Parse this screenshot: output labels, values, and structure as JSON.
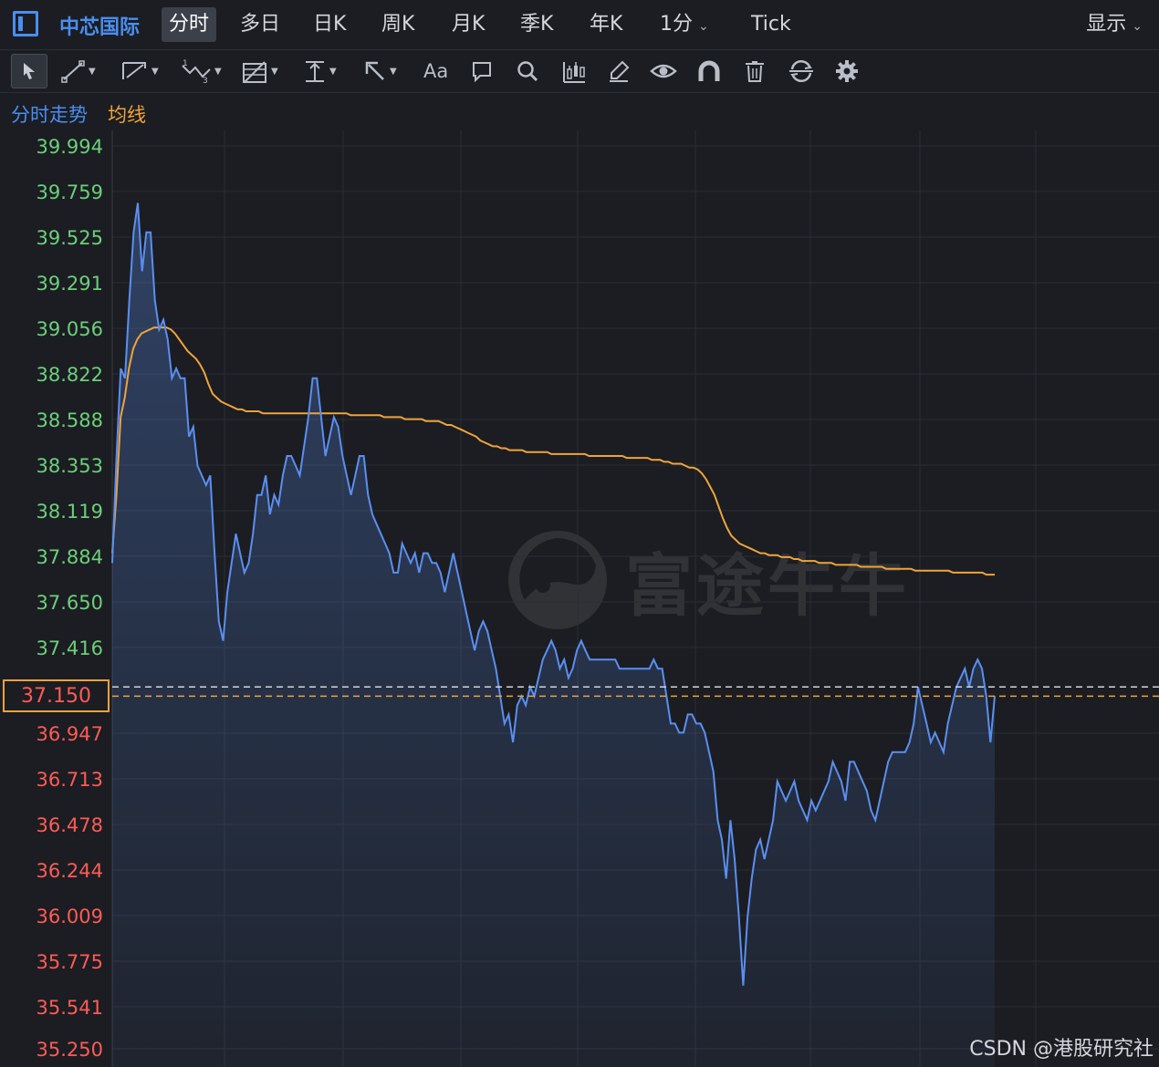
{
  "header": {
    "stock_name": "中芯国际",
    "tabs": [
      {
        "label": "分时",
        "active": true
      },
      {
        "label": "多日",
        "active": false
      },
      {
        "label": "日K",
        "active": false
      },
      {
        "label": "周K",
        "active": false
      },
      {
        "label": "月K",
        "active": false
      },
      {
        "label": "季K",
        "active": false
      },
      {
        "label": "年K",
        "active": false
      },
      {
        "label": "1分",
        "active": false
      },
      {
        "label": "Tick",
        "active": false
      }
    ],
    "display_menu": "显示"
  },
  "toolbar": {
    "icons": [
      "cursor-icon",
      "line-icon",
      "channel-icon",
      "wave-icon",
      "fib-icon",
      "measure-icon",
      "arrow-icon",
      "text-icon",
      "comment-icon",
      "zoom-icon",
      "candles-icon",
      "brush-icon",
      "eye-icon",
      "magnet-icon",
      "trash-icon",
      "sync-icon",
      "settings-icon"
    ],
    "text_tool_label": "Aa"
  },
  "legend": {
    "price_line": "分时走势",
    "avg_line": "均线"
  },
  "chart_data": {
    "type": "line",
    "title": "",
    "y_ticks": [
      "39.994",
      "39.759",
      "39.525",
      "39.291",
      "39.056",
      "38.822",
      "38.588",
      "38.353",
      "38.119",
      "37.884",
      "37.650",
      "37.416",
      "36.947",
      "36.713",
      "36.478",
      "36.244",
      "36.009",
      "35.775",
      "35.541",
      "35.250"
    ],
    "current_price_label": "37.150",
    "ylim": [
      35.25,
      39.994
    ],
    "reference_line": 37.2,
    "series": [
      {
        "name": "分时走势",
        "color": "#5b8ff0",
        "values": [
          37.85,
          38.4,
          38.85,
          38.8,
          39.2,
          39.55,
          39.7,
          39.35,
          39.55,
          39.55,
          39.2,
          39.05,
          39.1,
          39.0,
          38.8,
          38.85,
          38.8,
          38.8,
          38.5,
          38.55,
          38.35,
          38.3,
          38.25,
          38.3,
          37.9,
          37.55,
          37.45,
          37.7,
          37.85,
          38.0,
          37.9,
          37.8,
          37.85,
          38.0,
          38.2,
          38.2,
          38.3,
          38.1,
          38.2,
          38.15,
          38.3,
          38.4,
          38.4,
          38.35,
          38.3,
          38.45,
          38.6,
          38.8,
          38.8,
          38.6,
          38.4,
          38.5,
          38.6,
          38.55,
          38.4,
          38.3,
          38.2,
          38.3,
          38.4,
          38.4,
          38.2,
          38.1,
          38.05,
          38.0,
          37.95,
          37.9,
          37.8,
          37.8,
          37.95,
          37.9,
          37.85,
          37.9,
          37.8,
          37.9,
          37.9,
          37.85,
          37.85,
          37.8,
          37.7,
          37.8,
          37.9,
          37.8,
          37.7,
          37.6,
          37.5,
          37.4,
          37.5,
          37.55,
          37.5,
          37.4,
          37.3,
          37.15,
          37.0,
          37.05,
          36.9,
          37.1,
          37.15,
          37.1,
          37.2,
          37.15,
          37.25,
          37.35,
          37.4,
          37.45,
          37.4,
          37.3,
          37.35,
          37.25,
          37.3,
          37.4,
          37.45,
          37.4,
          37.35,
          37.35,
          37.35,
          37.35,
          37.35,
          37.35,
          37.35,
          37.3,
          37.3,
          37.3,
          37.3,
          37.3,
          37.3,
          37.3,
          37.3,
          37.35,
          37.3,
          37.3,
          37.15,
          37.0,
          37.0,
          36.95,
          36.95,
          37.05,
          37.05,
          37.0,
          37.0,
          36.95,
          36.85,
          36.75,
          36.5,
          36.4,
          36.2,
          36.5,
          36.3,
          36.0,
          35.65,
          36.0,
          36.2,
          36.35,
          36.4,
          36.3,
          36.4,
          36.5,
          36.7,
          36.65,
          36.6,
          36.65,
          36.7,
          36.6,
          36.55,
          36.5,
          36.6,
          36.55,
          36.6,
          36.65,
          36.7,
          36.8,
          36.75,
          36.7,
          36.6,
          36.8,
          36.8,
          36.75,
          36.7,
          36.65,
          36.55,
          36.5,
          36.6,
          36.7,
          36.8,
          36.85,
          36.85,
          36.85,
          36.85,
          36.9,
          37.0,
          37.2,
          37.1,
          37.0,
          36.9,
          36.95,
          36.9,
          36.85,
          37.0,
          37.1,
          37.2,
          37.25,
          37.3,
          37.2,
          37.3,
          37.35,
          37.3,
          37.15,
          36.9,
          37.15
        ]
      },
      {
        "name": "均线",
        "color": "#f0a33a",
        "values": [
          37.9,
          38.2,
          38.6,
          38.7,
          38.85,
          38.95,
          39.0,
          39.03,
          39.04,
          39.05,
          39.06,
          39.06,
          39.06,
          39.06,
          39.05,
          39.03,
          39.0,
          38.97,
          38.94,
          38.92,
          38.9,
          38.87,
          38.83,
          38.77,
          38.72,
          38.7,
          38.68,
          38.67,
          38.66,
          38.65,
          38.64,
          38.64,
          38.63,
          38.63,
          38.63,
          38.63,
          38.62,
          38.62,
          38.62,
          38.62,
          38.62,
          38.62,
          38.62,
          38.62,
          38.62,
          38.62,
          38.62,
          38.62,
          38.62,
          38.62,
          38.62,
          38.62,
          38.62,
          38.62,
          38.62,
          38.62,
          38.62,
          38.61,
          38.61,
          38.61,
          38.61,
          38.61,
          38.61,
          38.61,
          38.61,
          38.6,
          38.6,
          38.6,
          38.6,
          38.6,
          38.59,
          38.59,
          38.59,
          38.59,
          38.59,
          38.58,
          38.58,
          38.58,
          38.58,
          38.57,
          38.56,
          38.56,
          38.55,
          38.54,
          38.53,
          38.52,
          38.51,
          38.5,
          38.48,
          38.47,
          38.46,
          38.45,
          38.45,
          38.44,
          38.44,
          38.43,
          38.43,
          38.43,
          38.43,
          38.42,
          38.42,
          38.42,
          38.42,
          38.42,
          38.42,
          38.41,
          38.41,
          38.41,
          38.41,
          38.41,
          38.41,
          38.41,
          38.41,
          38.41,
          38.4,
          38.4,
          38.4,
          38.4,
          38.4,
          38.4,
          38.4,
          38.4,
          38.4,
          38.39,
          38.39,
          38.39,
          38.39,
          38.39,
          38.39,
          38.38,
          38.38,
          38.38,
          38.37,
          38.37,
          38.36,
          38.36,
          38.36,
          38.35,
          38.34,
          38.34,
          38.33,
          38.31,
          38.28,
          38.24,
          38.2,
          38.14,
          38.08,
          38.03,
          37.99,
          37.97,
          37.95,
          37.94,
          37.93,
          37.92,
          37.91,
          37.9,
          37.9,
          37.89,
          37.89,
          37.89,
          37.88,
          37.88,
          37.88,
          37.87,
          37.87,
          37.86,
          37.86,
          37.86,
          37.86,
          37.85,
          37.85,
          37.85,
          37.85,
          37.84,
          37.84,
          37.84,
          37.84,
          37.84,
          37.84,
          37.83,
          37.83,
          37.83,
          37.83,
          37.83,
          37.83,
          37.82,
          37.82,
          37.82,
          37.82,
          37.82,
          37.82,
          37.82,
          37.81,
          37.81,
          37.81,
          37.81,
          37.81,
          37.81,
          37.81,
          37.81,
          37.81,
          37.8,
          37.8,
          37.8,
          37.8,
          37.8,
          37.8,
          37.8,
          37.8,
          37.79,
          37.79,
          37.79
        ]
      }
    ]
  },
  "watermark": "富途牛牛",
  "credit": "CSDN @港股研究社"
}
